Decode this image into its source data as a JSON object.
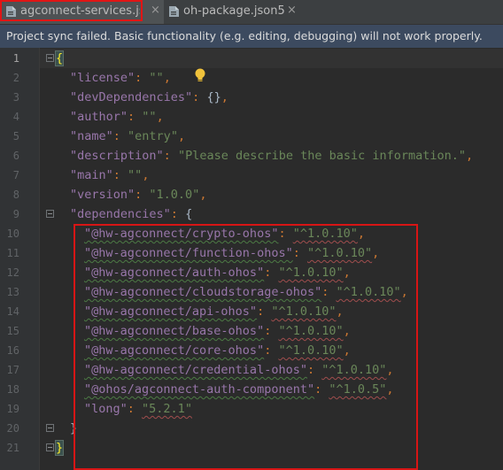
{
  "tabs": [
    {
      "label": "agconnect-services.json",
      "icon": "json-file-icon",
      "active": true
    },
    {
      "label": "oh-package.json5",
      "icon": "json-file-icon",
      "active": false
    }
  ],
  "close_glyph": "×",
  "banner": {
    "text": "Project sync failed. Basic functionality (e.g. editing, debugging) will not work properly."
  },
  "editor": {
    "line_numbers": [
      "1",
      "2",
      "3",
      "4",
      "5",
      "6",
      "7",
      "8",
      "9",
      "10",
      "11",
      "12",
      "13",
      "14",
      "15",
      "16",
      "17",
      "18",
      "19",
      "20",
      "21"
    ],
    "lines": {
      "l1": {
        "open": "{"
      },
      "l2": {
        "key": "\"license\"",
        "colon": ": ",
        "val": "\"\"",
        "comma": ","
      },
      "l3": {
        "key": "\"devDependencies\"",
        "colon": ": ",
        "val": "{}",
        "comma": ","
      },
      "l4": {
        "key": "\"author\"",
        "colon": ": ",
        "val": "\"\"",
        "comma": ","
      },
      "l5": {
        "key": "\"name\"",
        "colon": ": ",
        "val": "\"entry\"",
        "comma": ","
      },
      "l6": {
        "key": "\"description\"",
        "colon": ": ",
        "val": "\"Please describe the basic information.\"",
        "comma": ","
      },
      "l7": {
        "key": "\"main\"",
        "colon": ": ",
        "val": "\"\"",
        "comma": ","
      },
      "l8": {
        "key": "\"version\"",
        "colon": ": ",
        "val": "\"1.0.0\"",
        "comma": ","
      },
      "l9": {
        "key": "\"dependencies\"",
        "colon": ": ",
        "val": "{"
      },
      "l10": {
        "key": "\"@hw-agconnect/crypto-ohos\"",
        "colon": ": ",
        "val": "\"^1.0.10\"",
        "comma": ","
      },
      "l11": {
        "key": "\"@hw-agconnect/function-ohos\"",
        "colon": ": ",
        "val": "\"^1.0.10\"",
        "comma": ","
      },
      "l12": {
        "key": "\"@hw-agconnect/auth-ohos\"",
        "colon": ": ",
        "val": "\"^1.0.10\"",
        "comma": ","
      },
      "l13": {
        "key": "\"@hw-agconnect/cloudstorage-ohos\"",
        "colon": ": ",
        "val": "\"^1.0.10\"",
        "comma": ","
      },
      "l14": {
        "key": "\"@hw-agconnect/api-ohos\"",
        "colon": ": ",
        "val": "\"^1.0.10\"",
        "comma": ","
      },
      "l15": {
        "key": "\"@hw-agconnect/base-ohos\"",
        "colon": ": ",
        "val": "\"^1.0.10\"",
        "comma": ","
      },
      "l16": {
        "key": "\"@hw-agconnect/core-ohos\"",
        "colon": ": ",
        "val": "\"^1.0.10\"",
        "comma": ","
      },
      "l17": {
        "key": "\"@hw-agconnect/credential-ohos\"",
        "colon": ": ",
        "val": "\"^1.0.10\"",
        "comma": ","
      },
      "l18": {
        "key": "\"@ohos/agconnect-auth-component\"",
        "colon": ": ",
        "val": "\"^1.0.5\"",
        "comma": ","
      },
      "l19": {
        "key": "\"long\"",
        "colon": ": ",
        "val": "\"5.2.1\""
      },
      "l20": {
        "close": "}"
      },
      "l21": {
        "close": "}"
      }
    }
  },
  "colors": {
    "highlight_box": "#d71515",
    "json_key": "#9876aa",
    "json_string": "#6a8759",
    "punctuation": "#cc7832"
  }
}
